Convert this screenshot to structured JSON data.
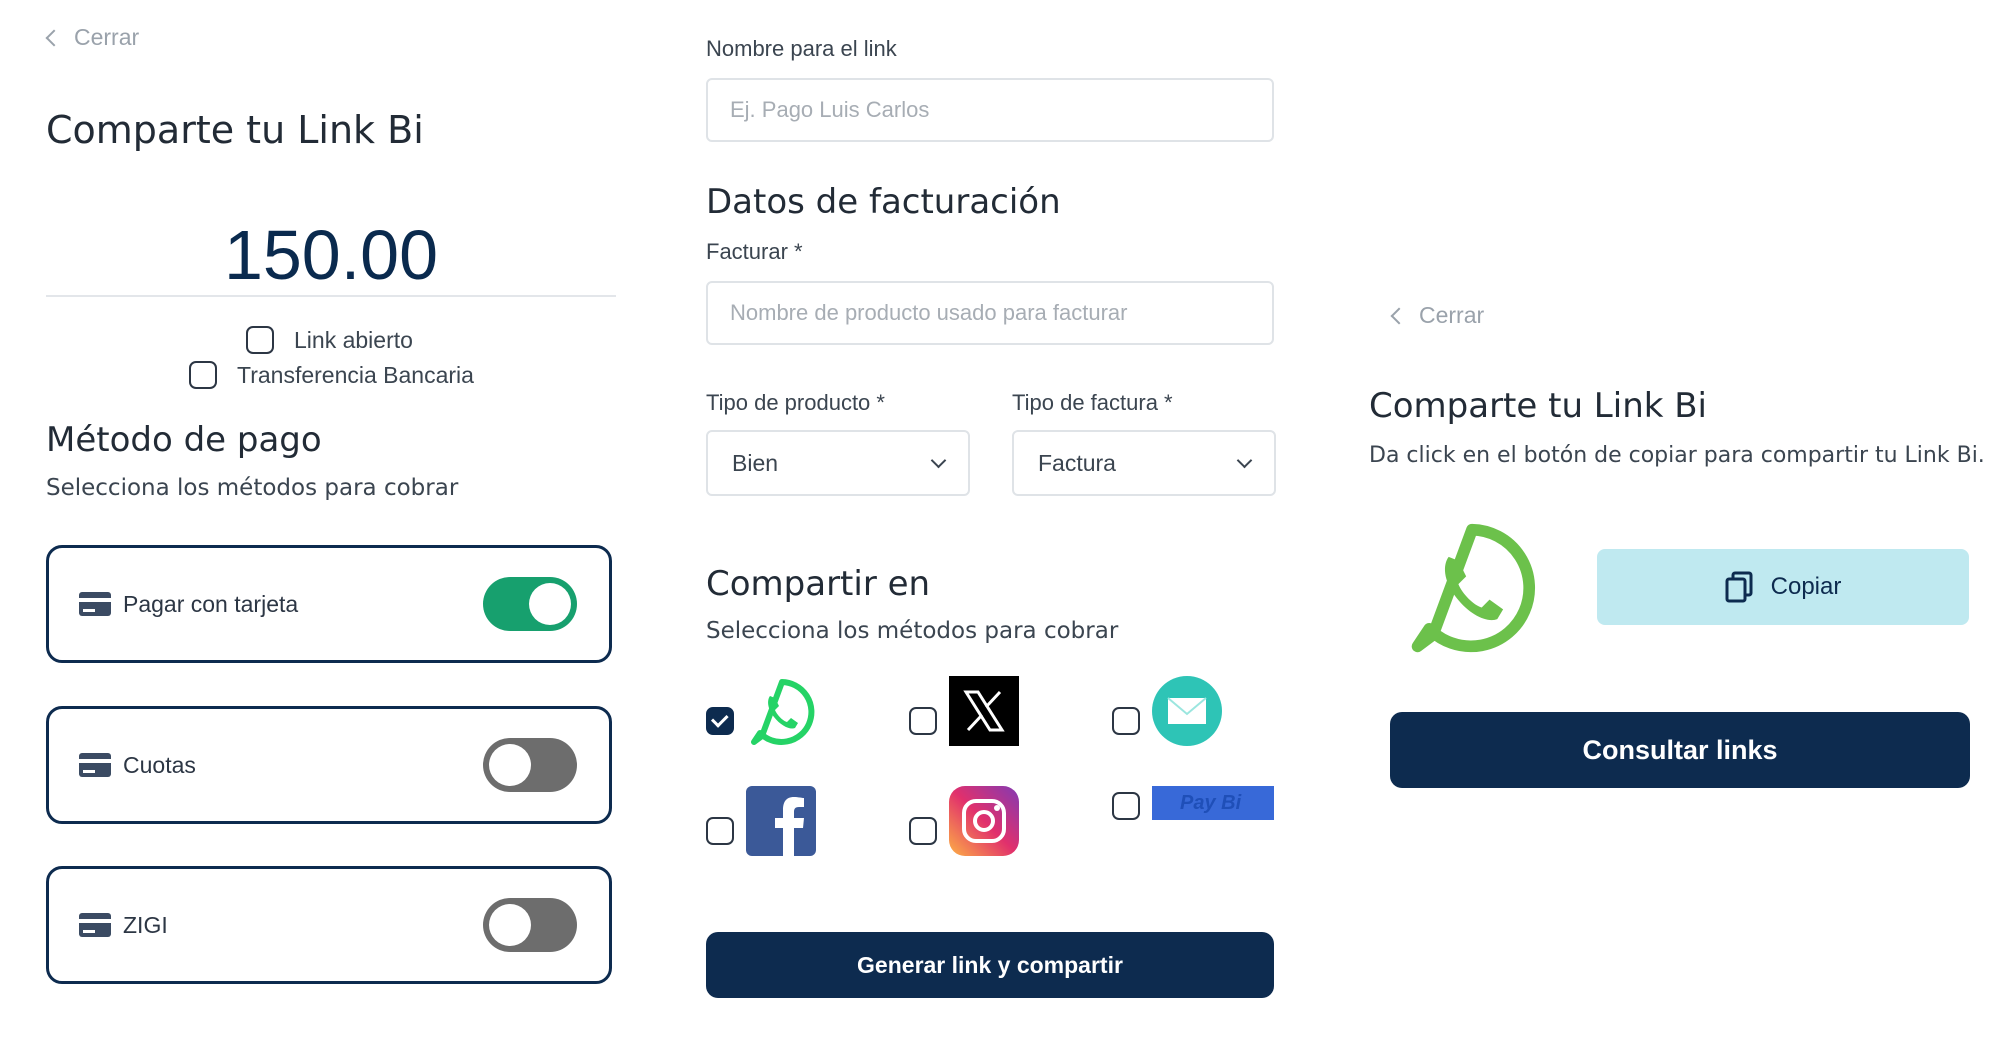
{
  "left_panel": {
    "close_label": "Cerrar",
    "title": "Comparte tu Link Bi",
    "amount": "150.00",
    "link_abierto_label": "Link abierto",
    "transferencia_label": "Transferencia Bancaria",
    "payment_title": "Método de pago",
    "payment_subtitle": "Selecciona los métodos para cobrar",
    "methods": [
      {
        "label": "Pagar con tarjeta",
        "enabled": true
      },
      {
        "label": "Cuotas",
        "enabled": false
      },
      {
        "label": "ZIGI",
        "enabled": false
      }
    ]
  },
  "middle_panel": {
    "link_name_label": "Nombre para el link",
    "link_name_placeholder": "Ej. Pago Luis Carlos",
    "billing_title": "Datos de facturación",
    "facturar_label": "Facturar *",
    "facturar_placeholder": "Nombre de producto usado para facturar",
    "product_type_label": "Tipo de producto *",
    "product_type_value": "Bien",
    "invoice_type_label": "Tipo de factura *",
    "invoice_type_value": "Factura",
    "share_title": "Compartir en",
    "share_subtitle": "Selecciona los métodos para cobrar",
    "share_options": [
      {
        "icon": "whatsapp-icon",
        "checked": true
      },
      {
        "icon": "x-icon",
        "checked": false
      },
      {
        "icon": "email-icon",
        "checked": false
      },
      {
        "icon": "facebook-icon",
        "checked": false
      },
      {
        "icon": "instagram-icon",
        "checked": false
      },
      {
        "icon": "paybi-logo",
        "checked": false
      }
    ],
    "paybi_logo_text": "Pay Bi",
    "generate_button": "Generar link y compartir"
  },
  "right_panel": {
    "close_label": "Cerrar",
    "title": "Comparte tu Link Bi",
    "subtitle": "Da click en el botón de copiar para compartir tu Link Bi.",
    "copy_button": "Copiar",
    "consult_button": "Consultar links"
  },
  "colors": {
    "navy": "#0d2b4f",
    "toggle_on": "#17a06e",
    "toggle_off": "#6d6d6d",
    "copy_bg": "#bfe9f0",
    "whatsapp_green": "#25d366"
  }
}
